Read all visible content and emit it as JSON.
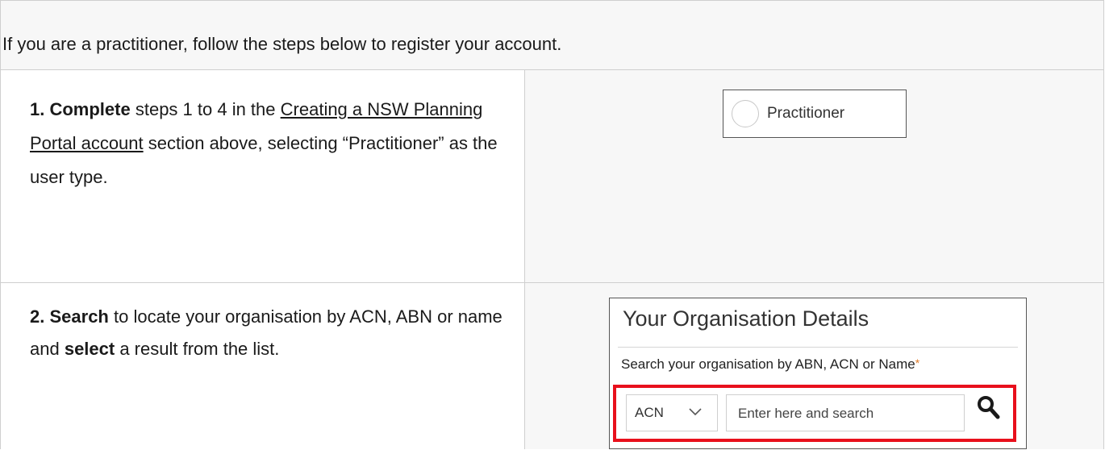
{
  "intro": {
    "text": "If you are a practitioner, follow the steps below to register your account."
  },
  "steps": [
    {
      "number": "1.",
      "keyword": "Complete",
      "text_before_link": " steps 1 to 4 in the ",
      "link_text": "Creating a NSW Planning Portal account",
      "text_after_link": " section above, selecting “Practitioner” as the user type.",
      "illustration": {
        "radio_label": "Practitioner"
      }
    },
    {
      "number": "2.",
      "keyword": "Search",
      "text_before_select": " to locate your organisation by ACN, ABN or name and ",
      "keyword2": "select",
      "text_after_select": " a result from the list.",
      "illustration": {
        "title": "Your Organisation Details",
        "search_label": "Search your organisation by ABN, ACN or Name",
        "required_marker": "*",
        "select_value": "ACN",
        "input_placeholder": "Enter here and search",
        "highlight_color": "#e8101c"
      }
    }
  ]
}
